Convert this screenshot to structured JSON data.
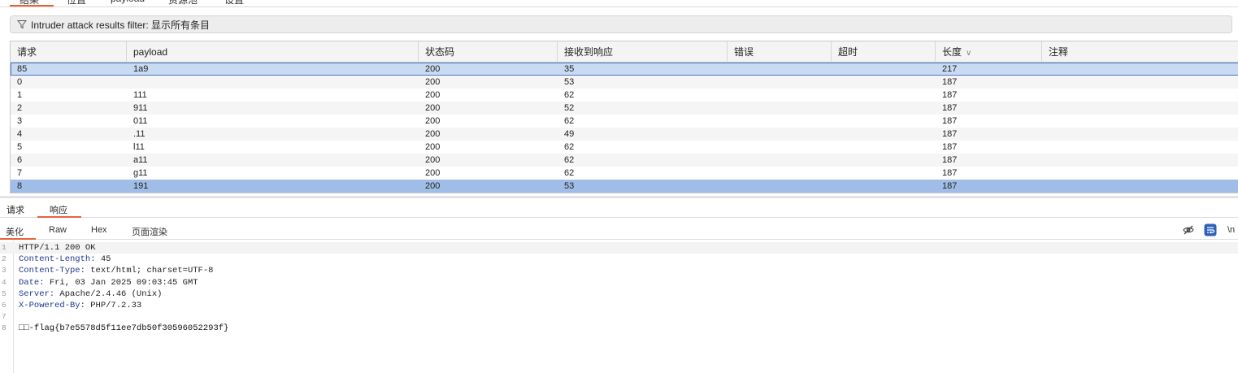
{
  "top_tabs": [
    "结果",
    "位置",
    "payload",
    "资源池",
    "设置"
  ],
  "filter": {
    "text": "Intruder attack results filter: 显示所有条目"
  },
  "table": {
    "columns": [
      "请求",
      "payload",
      "状态码",
      "接收到响应",
      "错误",
      "超时",
      "长度",
      "注释"
    ],
    "sorted_column": "长度",
    "rows": [
      {
        "request": "85",
        "payload": "1a9",
        "status": "200",
        "received": "35",
        "error": "",
        "timeout": "",
        "length": "217",
        "comment": ""
      },
      {
        "request": "0",
        "payload": "",
        "status": "200",
        "received": "53",
        "error": "",
        "timeout": "",
        "length": "187",
        "comment": ""
      },
      {
        "request": "1",
        "payload": "111",
        "status": "200",
        "received": "62",
        "error": "",
        "timeout": "",
        "length": "187",
        "comment": ""
      },
      {
        "request": "2",
        "payload": "911",
        "status": "200",
        "received": "52",
        "error": "",
        "timeout": "",
        "length": "187",
        "comment": ""
      },
      {
        "request": "3",
        "payload": "011",
        "status": "200",
        "received": "62",
        "error": "",
        "timeout": "",
        "length": "187",
        "comment": ""
      },
      {
        "request": "4",
        "payload": ".11",
        "status": "200",
        "received": "49",
        "error": "",
        "timeout": "",
        "length": "187",
        "comment": ""
      },
      {
        "request": "5",
        "payload": "l11",
        "status": "200",
        "received": "62",
        "error": "",
        "timeout": "",
        "length": "187",
        "comment": ""
      },
      {
        "request": "6",
        "payload": "a11",
        "status": "200",
        "received": "62",
        "error": "",
        "timeout": "",
        "length": "187",
        "comment": ""
      },
      {
        "request": "7",
        "payload": "g11",
        "status": "200",
        "received": "62",
        "error": "",
        "timeout": "",
        "length": "187",
        "comment": ""
      },
      {
        "request": "8",
        "payload": "191",
        "status": "200",
        "received": "53",
        "error": "",
        "timeout": "",
        "length": "187",
        "comment": ""
      }
    ]
  },
  "rr_tabs": {
    "request": "请求",
    "response": "响应",
    "active": "响应"
  },
  "view_tabs": {
    "pretty": "美化",
    "raw": "Raw",
    "hex": "Hex",
    "render": "页面渲染",
    "active": "美化",
    "newline_toggle": "\\n"
  },
  "response": {
    "lines": [
      {
        "num": "1",
        "kind": "status",
        "text": "HTTP/1.1 200 OK"
      },
      {
        "num": "2",
        "kind": "header",
        "name": "Content-Length:",
        "value": " 45"
      },
      {
        "num": "3",
        "kind": "header",
        "name": "Content-Type:",
        "value": " text/html; charset=UTF-8"
      },
      {
        "num": "4",
        "kind": "header",
        "name": "Date:",
        "value": " Fri, 03 Jan 2025 09:03:45 GMT"
      },
      {
        "num": "5",
        "kind": "header",
        "name": "Server:",
        "value": " Apache/2.4.46 (Unix)"
      },
      {
        "num": "6",
        "kind": "header",
        "name": "X-Powered-By:",
        "value": " PHP/7.2.33"
      },
      {
        "num": "7",
        "kind": "blank",
        "text": ""
      },
      {
        "num": "8",
        "kind": "body",
        "text": "□□-flag{b7e5578d5f11ee7db50f30596052293f}"
      }
    ]
  },
  "colors": {
    "accent": "#e8623a",
    "selected_row": "#9fbde6",
    "focused_row": "#c9daf3",
    "header_name": "#1f3a8a"
  },
  "icons": [
    "filter-icon",
    "sort-chevron-down-icon",
    "eye-off-icon",
    "wrap-icon"
  ]
}
